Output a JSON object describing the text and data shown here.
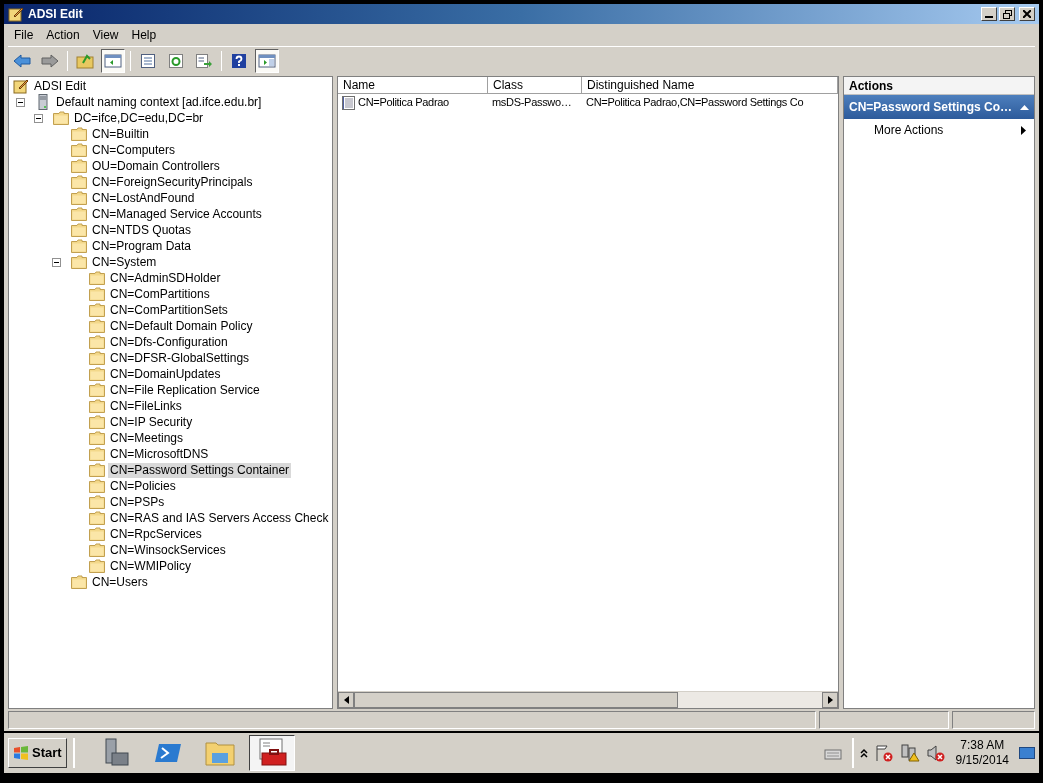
{
  "window": {
    "title": "ADSI Edit"
  },
  "menu": [
    "File",
    "Action",
    "View",
    "Help"
  ],
  "toolbar": [
    {
      "kind": "back",
      "pressed": false
    },
    {
      "kind": "forward",
      "pressed": false
    },
    {
      "kind": "sep"
    },
    {
      "kind": "up",
      "pressed": false
    },
    {
      "kind": "tree",
      "pressed": true
    },
    {
      "kind": "sep"
    },
    {
      "kind": "properties",
      "pressed": false
    },
    {
      "kind": "refresh",
      "pressed": false
    },
    {
      "kind": "export",
      "pressed": false
    },
    {
      "kind": "sep"
    },
    {
      "kind": "help",
      "pressed": false
    },
    {
      "kind": "actionpane",
      "pressed": true
    }
  ],
  "tree": [
    {
      "label": "ADSI Edit",
      "kind": "root",
      "selected": false,
      "children": [
        {
          "label": "Default naming context [ad.ifce.edu.br]",
          "kind": "server",
          "selected": false,
          "expanded": true,
          "children": [
            {
              "label": "DC=ifce,DC=edu,DC=br",
              "kind": "folder",
              "selected": false,
              "expanded": true,
              "children": [
                {
                  "label": "CN=Builtin",
                  "kind": "folder",
                  "selected": false
                },
                {
                  "label": "CN=Computers",
                  "kind": "folder",
                  "selected": false
                },
                {
                  "label": "OU=Domain Controllers",
                  "kind": "folder",
                  "selected": false
                },
                {
                  "label": "CN=ForeignSecurityPrincipals",
                  "kind": "folder",
                  "selected": false
                },
                {
                  "label": "CN=LostAndFound",
                  "kind": "folder",
                  "selected": false
                },
                {
                  "label": "CN=Managed Service Accounts",
                  "kind": "folder",
                  "selected": false
                },
                {
                  "label": "CN=NTDS Quotas",
                  "kind": "folder",
                  "selected": false
                },
                {
                  "label": "CN=Program Data",
                  "kind": "folder",
                  "selected": false
                },
                {
                  "label": "CN=System",
                  "kind": "folder",
                  "selected": false,
                  "expanded": true,
                  "children": [
                    {
                      "label": "CN=AdminSDHolder",
                      "kind": "folder",
                      "selected": false
                    },
                    {
                      "label": "CN=ComPartitions",
                      "kind": "folder",
                      "selected": false
                    },
                    {
                      "label": "CN=ComPartitionSets",
                      "kind": "folder",
                      "selected": false
                    },
                    {
                      "label": "CN=Default Domain Policy",
                      "kind": "folder",
                      "selected": false
                    },
                    {
                      "label": "CN=Dfs-Configuration",
                      "kind": "folder",
                      "selected": false
                    },
                    {
                      "label": "CN=DFSR-GlobalSettings",
                      "kind": "folder",
                      "selected": false
                    },
                    {
                      "label": "CN=DomainUpdates",
                      "kind": "folder",
                      "selected": false
                    },
                    {
                      "label": "CN=File Replication Service",
                      "kind": "folder",
                      "selected": false
                    },
                    {
                      "label": "CN=FileLinks",
                      "kind": "folder",
                      "selected": false
                    },
                    {
                      "label": "CN=IP Security",
                      "kind": "folder",
                      "selected": false
                    },
                    {
                      "label": "CN=Meetings",
                      "kind": "folder",
                      "selected": false
                    },
                    {
                      "label": "CN=MicrosoftDNS",
                      "kind": "folder",
                      "selected": false
                    },
                    {
                      "label": "CN=Password Settings Container",
                      "kind": "folder",
                      "selected": true
                    },
                    {
                      "label": "CN=Policies",
                      "kind": "folder",
                      "selected": false
                    },
                    {
                      "label": "CN=PSPs",
                      "kind": "folder",
                      "selected": false
                    },
                    {
                      "label": "CN=RAS and IAS Servers Access Check",
                      "kind": "folder",
                      "selected": false
                    },
                    {
                      "label": "CN=RpcServices",
                      "kind": "folder",
                      "selected": false
                    },
                    {
                      "label": "CN=WinsockServices",
                      "kind": "folder",
                      "selected": false
                    },
                    {
                      "label": "CN=WMIPolicy",
                      "kind": "folder",
                      "selected": false
                    }
                  ]
                },
                {
                  "label": "CN=Users",
                  "kind": "folder",
                  "selected": false
                }
              ]
            }
          ]
        }
      ]
    }
  ],
  "list": {
    "columns": [
      "Name",
      "Class",
      "Distinguished Name"
    ],
    "rows": [
      {
        "cells": [
          "CN=Politica Padrao",
          "msDS-Passwo…",
          "CN=Politica Padrao,CN=Password Settings Co"
        ]
      }
    ]
  },
  "actions": {
    "title": "Actions",
    "section": "CN=Password Settings Co…",
    "items": [
      "More Actions"
    ]
  },
  "taskbar": {
    "start": "Start",
    "apps": [
      {
        "kind": "server-manager",
        "selected": false
      },
      {
        "kind": "powershell",
        "selected": false
      },
      {
        "kind": "explorer",
        "selected": false
      },
      {
        "kind": "toolbox",
        "selected": true
      }
    ],
    "time": "7:38 AM",
    "date": "9/15/2014"
  }
}
